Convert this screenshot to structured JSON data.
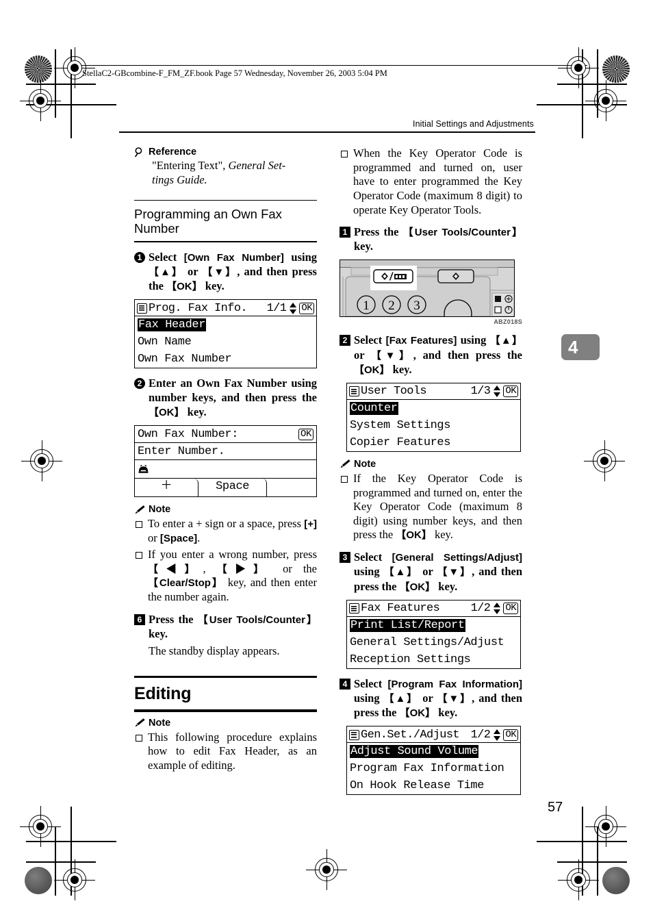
{
  "banner": {
    "text": "StellaC2-GBcombine-F_FM_ZF.book  Page 57  Wednesday, November 26, 2003  5:04 PM"
  },
  "running_head": {
    "text": "Initial Settings and Adjustments"
  },
  "chapter_tab": {
    "number": "4"
  },
  "folio": {
    "page_number": "57"
  },
  "left_column": {
    "reference": {
      "icon": "magnifier-icon",
      "heading": "Reference",
      "body_quote": "\"Entering Text\", ",
      "body_italic": "General Set-",
      "body_italic2": "tings Guide."
    },
    "subhead": "Programming an Own Fax Number",
    "step1": {
      "number": "1",
      "text_a": "Select ",
      "bracket_a": "[Own Fax Number]",
      "text_b": " using ",
      "key_up": "【▲】",
      "text_c": " or ",
      "key_down": "【▼】",
      "text_d": ", and then press the ",
      "key_ok": "【OK】",
      "text_e": " key."
    },
    "lcd1": {
      "menu_icon": "menu-icon",
      "title": "Prog. Fax Info.",
      "page": "1/1",
      "updown_icon": "up-down-arrows-icon",
      "ok": "OK",
      "rows": [
        {
          "label": "Fax Header",
          "selected": true
        },
        {
          "label": "Own Name",
          "selected": false
        },
        {
          "label": "Own Fax Number",
          "selected": false
        }
      ]
    },
    "step2": {
      "number": "2",
      "text_a": "Enter an Own Fax Number using number keys, and then press the ",
      "key_ok": "【OK】",
      "text_b": " key."
    },
    "lcd2": {
      "title": "Own Fax Number:",
      "ok": "OK",
      "prompt": "Enter Number.",
      "phone_icon": "telephone-icon",
      "tabs": [
        "＋",
        "Space",
        ""
      ]
    },
    "note1": {
      "icon": "pencil-icon",
      "heading": "Note",
      "items": [
        {
          "parts": [
            {
              "t": "To enter a + sign or a space, press ",
              "b": false
            },
            {
              "t": "[+]",
              "b": true
            },
            {
              "t": " or ",
              "b": false
            },
            {
              "t": "[Space]",
              "b": true
            },
            {
              "t": ".",
              "b": false
            }
          ]
        },
        {
          "parts": [
            {
              "t": "If you enter a wrong number, press ",
              "b": false
            },
            {
              "t": "【◀】",
              "b": true
            },
            {
              "t": ", ",
              "b": false
            },
            {
              "t": "【▶】",
              "b": true
            },
            {
              "t": " or the ",
              "b": false
            },
            {
              "t": "【Clear/Stop】",
              "b": true
            },
            {
              "t": " key, and then enter the number again.",
              "b": false
            }
          ]
        }
      ]
    },
    "step6": {
      "number": "6",
      "text_a": "Press the ",
      "key": "【User Tools/Counter】",
      "text_b": " key.",
      "sub": "The standby display appears."
    },
    "h1": "Editing",
    "note2": {
      "icon": "pencil-icon",
      "heading": "Note",
      "items": [
        {
          "text": "This following procedure explains how to edit Fax Header, as an example of editing."
        }
      ]
    }
  },
  "right_column": {
    "note_top": {
      "text": "When the Key Operator Code is programmed and turned on, user have to enter programmed the Key Operator Code (maximum 8 digit) to operate Key Operator Tools."
    },
    "step1": {
      "number": "1",
      "text_a": "Press the ",
      "key": "【User Tools/Counter】",
      "text_b": " key."
    },
    "figure": {
      "name": "control-panel-illustration",
      "caption": "ABZ018S",
      "keys": [
        "1",
        "2",
        "3"
      ],
      "highlighted_key": "user-tools-counter-key"
    },
    "step2": {
      "number": "2",
      "text_a": "Select ",
      "bracket_a": "[Fax Features]",
      "text_b": " using ",
      "key_up": "【▲】",
      "text_c": " or ",
      "key_down": "【▼】",
      "text_d": ", and then press the ",
      "key_ok": "【OK】",
      "text_e": " key."
    },
    "lcd1": {
      "menu_icon": "menu-icon",
      "title": "User Tools",
      "page": "1/3",
      "ok": "OK",
      "rows": [
        {
          "label": "Counter",
          "selected": true
        },
        {
          "label": "System Settings",
          "selected": false
        },
        {
          "label": "Copier Features",
          "selected": false
        }
      ]
    },
    "note1": {
      "icon": "pencil-icon",
      "heading": "Note",
      "items": [
        {
          "parts": [
            {
              "t": "If the Key Operator Code is programmed and turned on, enter the Key Operator Code (maximum 8 digit) using number keys, and then press the ",
              "b": false
            },
            {
              "t": "【OK】",
              "b": true
            },
            {
              "t": " key.",
              "b": false
            }
          ]
        }
      ]
    },
    "step3": {
      "number": "3",
      "text_a": "Select ",
      "bracket_a": "[General Settings/Adjust]",
      "text_b": " using ",
      "key_up": "【▲】",
      "text_c": " or ",
      "key_down": "【▼】",
      "text_d": ", and then press the ",
      "key_ok": "【OK】",
      "text_e": " key."
    },
    "lcd2": {
      "menu_icon": "menu-icon",
      "title": "Fax Features",
      "page": "1/2",
      "ok": "OK",
      "rows": [
        {
          "label": "Print List/Report",
          "selected": true
        },
        {
          "label": "General Settings/Adjust",
          "selected": false
        },
        {
          "label": "Reception Settings",
          "selected": false
        }
      ]
    },
    "step4": {
      "number": "4",
      "text_a": "Select ",
      "bracket_a": "[Program Fax Information]",
      "text_b": " using ",
      "key_up": "【▲】",
      "text_c": " or ",
      "key_down": "【▼】",
      "text_d": ", and then press the ",
      "key_ok": "【OK】",
      "text_e": " key."
    },
    "lcd3": {
      "menu_icon": "menu-icon",
      "title": "Gen.Set./Adjust",
      "page": "1/2",
      "ok": "OK",
      "rows": [
        {
          "label": "Adjust Sound Volume",
          "selected": true
        },
        {
          "label": "Program Fax Information",
          "selected": false
        },
        {
          "label": "On Hook Release Time",
          "selected": false
        }
      ]
    }
  }
}
